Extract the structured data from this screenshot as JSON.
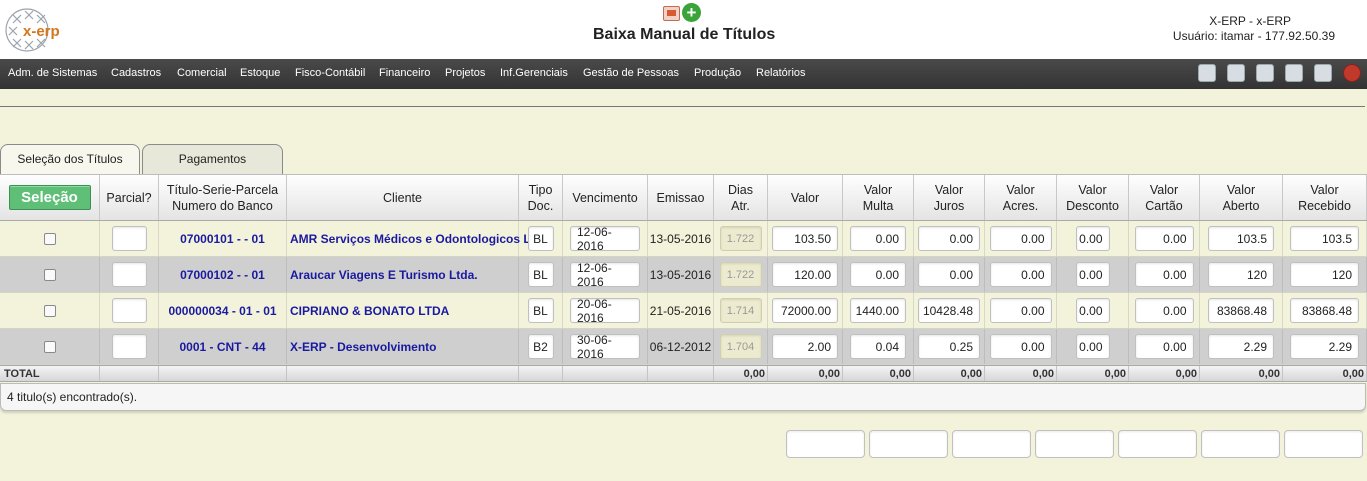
{
  "app": {
    "title": "Baixa Manual de Títulos",
    "logo_text": "x-erp",
    "system_name": "X-ERP - x-ERP",
    "user_info": "Usuário: itamar - 177.92.50.39"
  },
  "menu": [
    {
      "label": "Adm. de Sistemas",
      "width": 103
    },
    {
      "label": "Cadastros",
      "width": 66
    },
    {
      "label": "Comercial",
      "width": 63
    },
    {
      "label": "Estoque",
      "width": 55
    },
    {
      "label": "Fisco-Contábil",
      "width": 84
    },
    {
      "label": "Financeiro",
      "width": 66
    },
    {
      "label": "Projetos",
      "width": 55
    },
    {
      "label": "Inf.Gerenciais",
      "width": 83
    },
    {
      "label": "Gestão de Pessoas",
      "width": 111
    },
    {
      "label": "Produção",
      "width": 62
    },
    {
      "label": "Relatórios",
      "width": 60
    }
  ],
  "toolbar_icons": [
    "home-icon",
    "print-icon",
    "document-icon",
    "notes-icon",
    "help-icon",
    "power-icon"
  ],
  "tabs": [
    "Seleção dos Títulos",
    "Pagamentos"
  ],
  "table": {
    "select_button": "Seleção",
    "columns": [
      "",
      "Parcial?",
      "Título-Serie-Parcela\nNumero do Banco",
      "Cliente",
      "Tipo\nDoc.",
      "Vencimento",
      "Emissao",
      "Dias\nAtr.",
      "Valor",
      "Valor\nMulta",
      "Valor\nJuros",
      "Valor\nAcres.",
      "Valor\nDesconto",
      "Valor\nCartão",
      "Valor\nAberto",
      "Valor\nRecebido"
    ],
    "rows": [
      {
        "titulo": "07000101 - - 01",
        "cliente": "AMR Serviços Médicos e Odontologicos LTDA",
        "tipo": "BL",
        "vencimento": "12-06-2016",
        "emissao": "13-05-2016",
        "dias": "1.722",
        "valor": "103.50",
        "multa": "0.00",
        "juros": "0.00",
        "acres": "0.00",
        "desconto": "0.00",
        "cartao": "0.00",
        "aberto": "103.5",
        "recebido": "103.5"
      },
      {
        "titulo": "07000102 - - 01",
        "cliente": "Araucar Viagens E Turismo Ltda.",
        "tipo": "BL",
        "vencimento": "12-06-2016",
        "emissao": "13-05-2016",
        "dias": "1.722",
        "valor": "120.00",
        "multa": "0.00",
        "juros": "0.00",
        "acres": "0.00",
        "desconto": "0.00",
        "cartao": "0.00",
        "aberto": "120",
        "recebido": "120"
      },
      {
        "titulo": "000000034 - 01 - 01",
        "cliente": "CIPRIANO & BONATO LTDA",
        "tipo": "BL",
        "vencimento": "20-06-2016",
        "emissao": "21-05-2016",
        "dias": "1.714",
        "valor": "72000.00",
        "multa": "1440.00",
        "juros": "10428.48",
        "acres": "0.00",
        "desconto": "0.00",
        "cartao": "0.00",
        "aberto": "83868.48",
        "recebido": "83868.48"
      },
      {
        "titulo": "0001 - CNT - 44",
        "cliente": "X-ERP - Desenvolvimento",
        "tipo": "B2",
        "vencimento": "30-06-2016",
        "emissao": "06-12-2012",
        "dias": "1.704",
        "valor": "2.00",
        "multa": "0.04",
        "juros": "0.25",
        "acres": "0.00",
        "desconto": "0.00",
        "cartao": "0.00",
        "aberto": "2.29",
        "recebido": "2.29"
      }
    ],
    "total_label": "TOTAL",
    "totals": [
      "0,00",
      "0,00",
      "0,00",
      "0,00",
      "0,00",
      "0,00",
      "0,00",
      "0,00",
      "0,00"
    ]
  },
  "summary": "4 titulo(s) encontrado(s).",
  "colors": {
    "menu_bg": "#3a3a3a",
    "page_bg": "#f3f3dc",
    "select_button": "#5fbf77",
    "link": "#1a1aa0",
    "even_row": "#cfcfcf"
  }
}
